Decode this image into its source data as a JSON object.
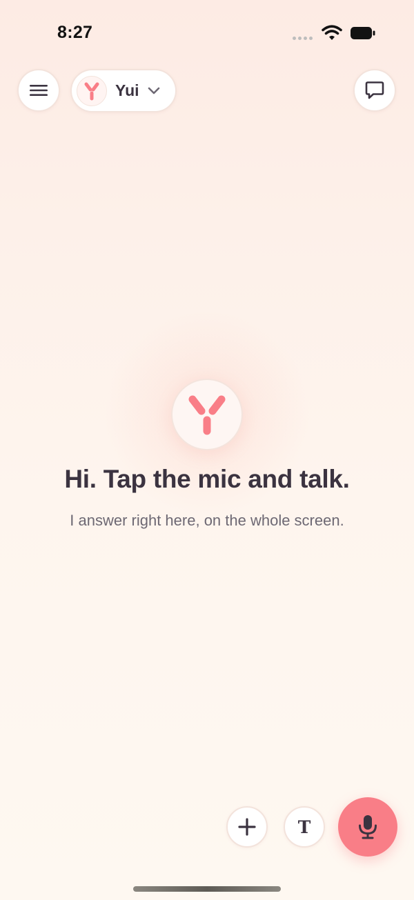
{
  "status_bar": {
    "time": "8:27"
  },
  "header": {
    "persona_name": "Yui"
  },
  "main": {
    "headline": "Hi. Tap the mic and talk.",
    "subline": "I answer right here, on the whole screen."
  },
  "bottom": {
    "text_mode_glyph": "T"
  },
  "colors": {
    "accent": "#f97e87",
    "text_primary": "#3b3340",
    "text_secondary": "#6d6873",
    "background_top": "#fdebe4",
    "background_bottom": "#fef8f1"
  },
  "icons": {
    "menu": "hamburger-icon",
    "persona_logo": "y-logo-icon",
    "dropdown": "chevron-down-icon",
    "chat": "chat-bubble-icon",
    "add": "plus-icon",
    "text_mode": "text-t-icon",
    "voice": "microphone-icon"
  }
}
